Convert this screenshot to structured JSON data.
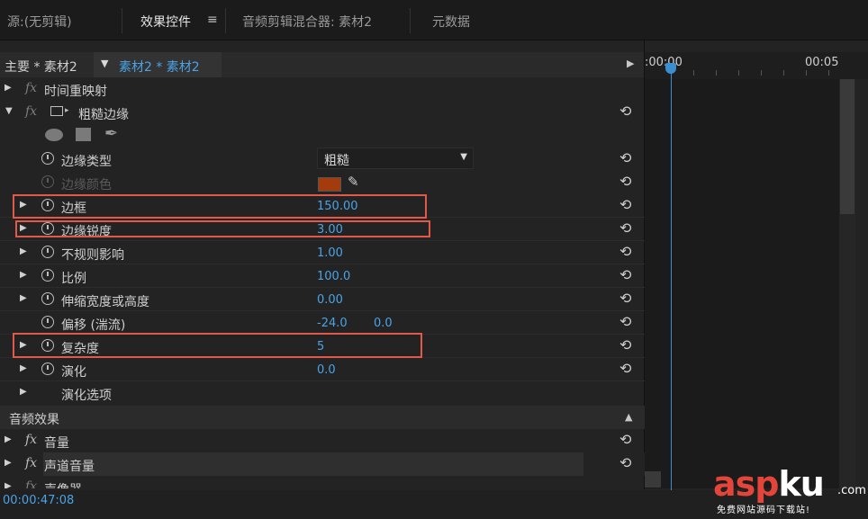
{
  "tabs": [
    {
      "label": "源:(无剪辑)"
    },
    {
      "label": "效果控件"
    },
    {
      "label": "音频剪辑混合器: 素材2"
    },
    {
      "label": "元数据"
    }
  ],
  "panel_menu_icon": "≡",
  "header": {
    "master_label": "主要 * 素材2",
    "clip_label": "素材2 * 素材2"
  },
  "timeline": {
    "start_time": ":00:00",
    "end_time": "00:05"
  },
  "effects": {
    "time_remap": "时间重映射",
    "rough_edges": "粗糙边缘",
    "props": {
      "edge_type": {
        "label": "边缘类型",
        "value": "粗糙"
      },
      "edge_color": {
        "label": "边缘颜色",
        "color": "#a43b0c"
      },
      "border": {
        "label": "边框",
        "value": "150.00"
      },
      "edge_sharpness": {
        "label": "边缘锐度",
        "value": "3.00"
      },
      "irregular": {
        "label": "不规则影响",
        "value": "1.00"
      },
      "scale": {
        "label": "比例",
        "value": "100.0"
      },
      "stretch": {
        "label": "伸缩宽度或高度",
        "value": "0.00"
      },
      "offset": {
        "label": "偏移 (湍流)",
        "value_x": "-24.0",
        "value_y": "0.0"
      },
      "complexity": {
        "label": "复杂度",
        "value": "5"
      },
      "evolution": {
        "label": "演化",
        "value": "0.0"
      },
      "evolution_options": {
        "label": "演化选项"
      }
    }
  },
  "audio": {
    "section_label": "音频效果",
    "volume": "音量",
    "channel_volume": "声道音量",
    "panner": "声像器"
  },
  "footer": {
    "timecode": "00:00:47:08"
  },
  "watermark": {
    "main_a": "asp",
    "main_b": "ku",
    "com": ".com",
    "sub": "免费网站源码下载站!"
  },
  "colors": {
    "accent": "#4aa3e6",
    "highlight_box": "#e2594a"
  }
}
